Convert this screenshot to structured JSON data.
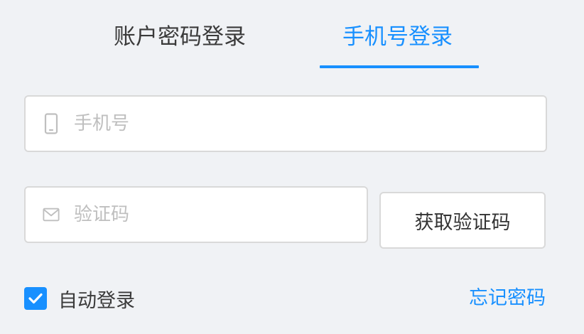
{
  "tabs": {
    "account_label": "账户密码登录",
    "mobile_label": "手机号登录",
    "active": "mobile"
  },
  "phone_field": {
    "placeholder": "手机号",
    "value": "",
    "icon": "mobile-icon"
  },
  "code_field": {
    "placeholder": "验证码",
    "value": "",
    "icon": "mail-icon"
  },
  "captcha_button": {
    "label": "获取验证码"
  },
  "remember": {
    "label": "自动登录",
    "checked": true
  },
  "forgot": {
    "label": "忘记密码"
  },
  "colors": {
    "primary": "#1890ff",
    "background": "#f0f2f5",
    "text": "#3a3a3a",
    "placeholder": "#bfbfbf",
    "border": "#d9d9d9"
  }
}
